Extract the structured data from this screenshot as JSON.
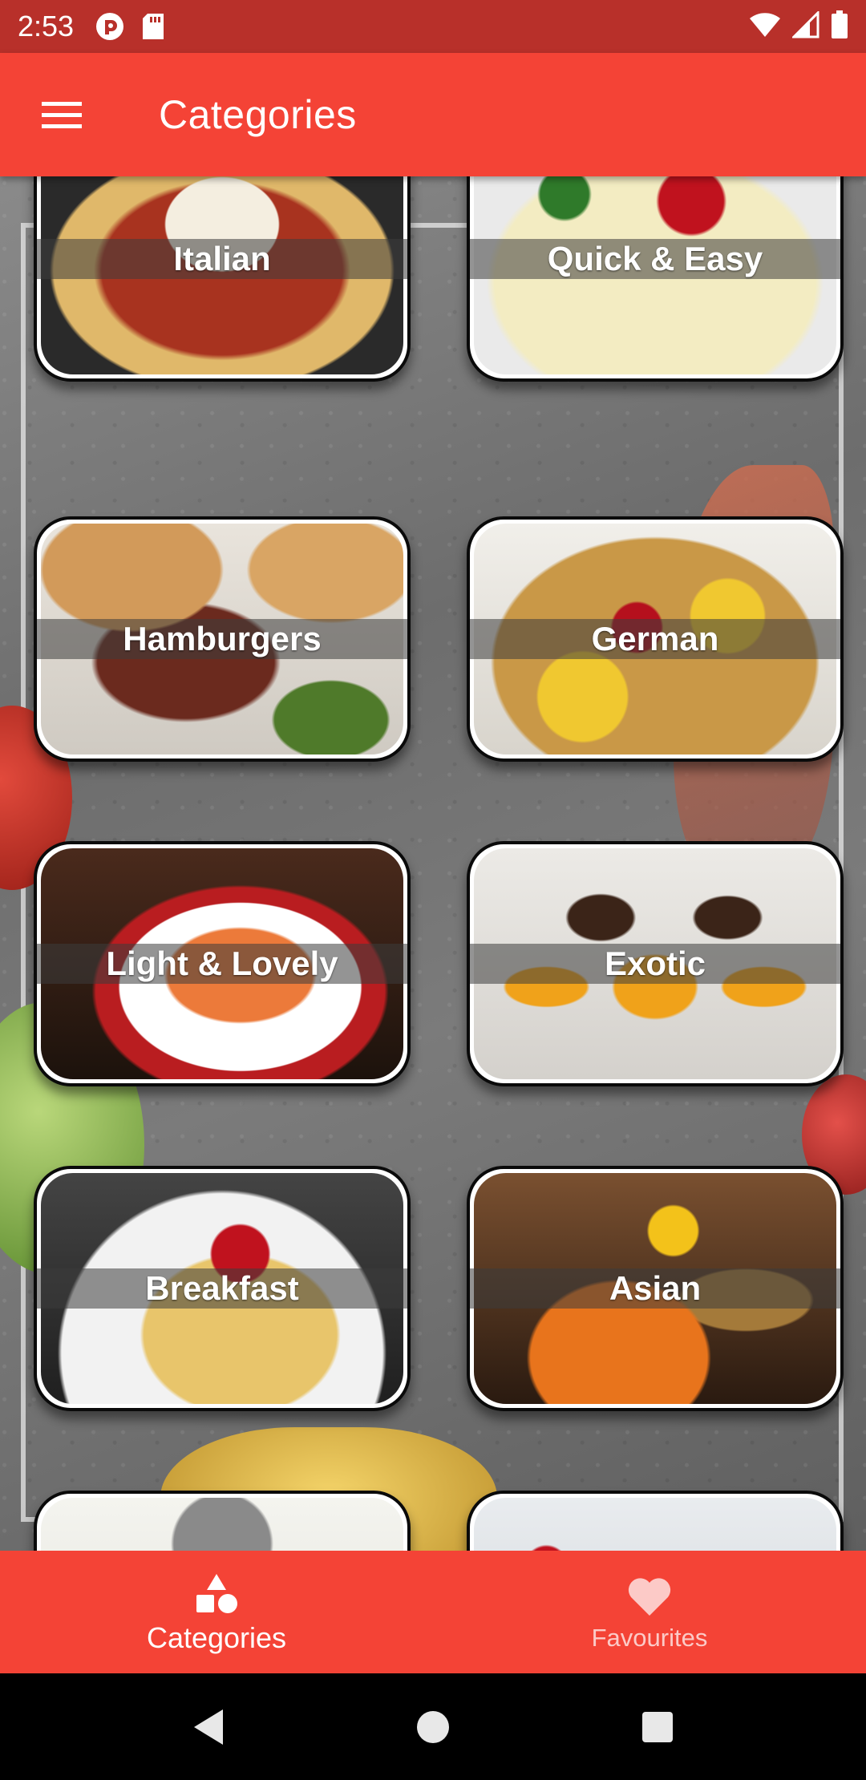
{
  "status_bar": {
    "time": "2:53",
    "left_icons": [
      "pocket-casts-icon",
      "sd-card-icon"
    ],
    "right_icons": [
      "wifi-icon",
      "cellular-signal-icon",
      "battery-icon"
    ]
  },
  "app_bar": {
    "title": "Categories",
    "menu_icon": "hamburger-menu-icon"
  },
  "categories": [
    {
      "label": "Italian"
    },
    {
      "label": "Quick & Easy"
    },
    {
      "label": "Hamburgers"
    },
    {
      "label": "German"
    },
    {
      "label": "Light & Lovely"
    },
    {
      "label": "Exotic"
    },
    {
      "label": "Breakfast"
    },
    {
      "label": "Asian"
    }
  ],
  "bottom_nav": {
    "items": [
      {
        "label": "Categories",
        "icon": "shapes-icon",
        "selected": true
      },
      {
        "label": "Favourites",
        "icon": "heart-icon",
        "selected": false
      }
    ]
  },
  "system_nav": {
    "buttons": [
      "back-icon",
      "home-icon",
      "recents-icon"
    ]
  },
  "colors": {
    "primary": "#f44336",
    "status_bar": "#b8302a"
  }
}
